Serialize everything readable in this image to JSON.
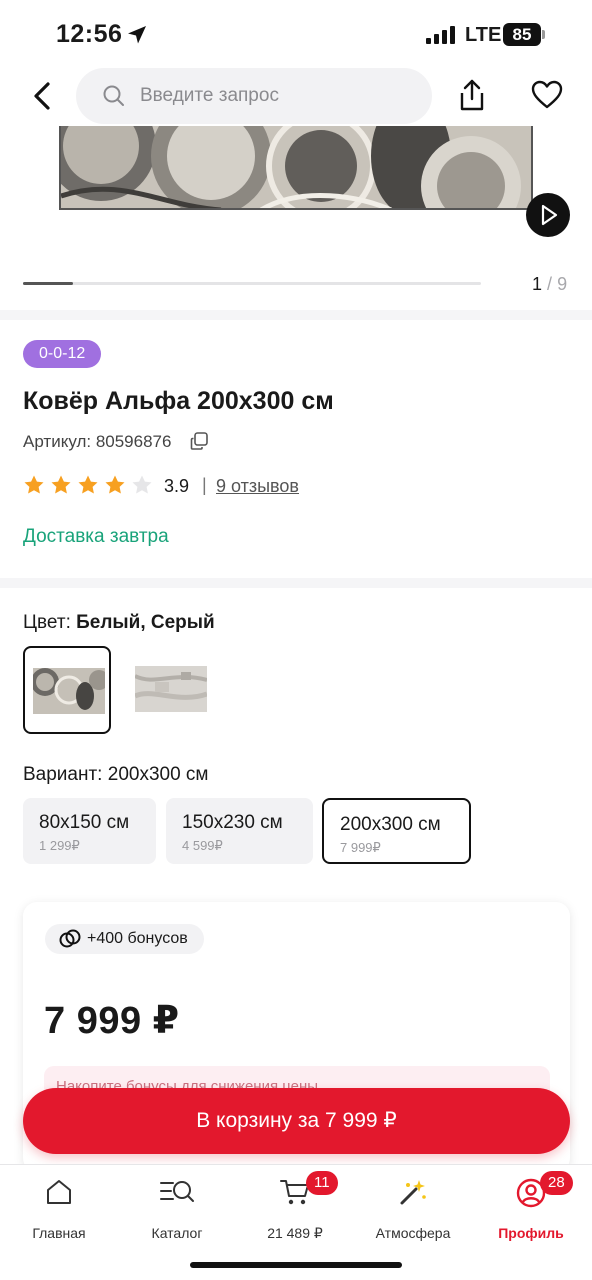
{
  "status_bar": {
    "time": "12:56",
    "network": "LTE",
    "battery": "85"
  },
  "search": {
    "placeholder": "Введите запрос"
  },
  "gallery": {
    "current": "1",
    "separator": "/",
    "total": "9",
    "progress": 0.11
  },
  "product": {
    "badge": "0-0-12",
    "title": "Ковёр Альфа 200x300 см",
    "sku": "Артикул: 80596876",
    "rating": "3.9",
    "rating_stars": 4,
    "rating_divider": "|",
    "reviews": "9 отзывов",
    "delivery": "Доставка завтра"
  },
  "color": {
    "label": "Цвет:",
    "value": "Белый, Серый"
  },
  "variant": {
    "label": "Вариант:",
    "value": "200x300 см",
    "options": [
      {
        "size": "80x150 см",
        "price": "1 299₽"
      },
      {
        "size": "150x230 см",
        "price": "4 599₽"
      },
      {
        "size": "200x300 см",
        "price": "7 999₽"
      }
    ]
  },
  "offer": {
    "bonus": "+400 бонусов",
    "price": "7 999 ₽",
    "promo": "Накопите бонусы для снижения цены"
  },
  "cart_button": "В корзину за 7 999 ₽",
  "tabbar": {
    "items": [
      {
        "label": "Главная",
        "badge": ""
      },
      {
        "label": "Каталог",
        "badge": ""
      },
      {
        "label": "21 489 ₽",
        "badge": "11"
      },
      {
        "label": "Атмосфера",
        "badge": ""
      },
      {
        "label": "Профиль",
        "badge": "28"
      }
    ]
  },
  "colors": {
    "accent": "#e3182d",
    "delivery": "#19a37a",
    "badge": "#a070e0",
    "star": "#f7a021"
  }
}
